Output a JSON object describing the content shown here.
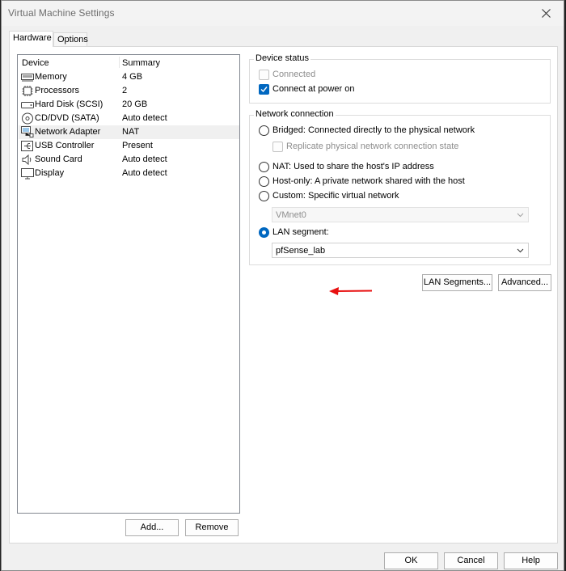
{
  "window": {
    "title": "Virtual Machine Settings"
  },
  "tabs": [
    {
      "label": "Hardware"
    },
    {
      "label": "Options"
    }
  ],
  "device_list": {
    "headers": {
      "device": "Device",
      "summary": "Summary"
    },
    "rows": [
      {
        "name": "Memory",
        "summary": "4 GB",
        "icon": "memory-icon"
      },
      {
        "name": "Processors",
        "summary": "2",
        "icon": "processor-icon"
      },
      {
        "name": "Hard Disk (SCSI)",
        "summary": "20 GB",
        "icon": "hard-disk-icon"
      },
      {
        "name": "CD/DVD (SATA)",
        "summary": "Auto detect",
        "icon": "cd-dvd-icon"
      },
      {
        "name": "Network Adapter",
        "summary": "NAT",
        "icon": "network-adapter-icon"
      },
      {
        "name": "USB Controller",
        "summary": "Present",
        "icon": "usb-icon"
      },
      {
        "name": "Sound Card",
        "summary": "Auto detect",
        "icon": "speaker-icon"
      },
      {
        "name": "Display",
        "summary": "Auto detect",
        "icon": "monitor-icon"
      }
    ],
    "add_label": "Add...",
    "remove_label": "Remove"
  },
  "device_status": {
    "title": "Device status",
    "connected": {
      "label": "Connected",
      "checked": false,
      "enabled": false
    },
    "connect_at_power_on": {
      "label": "Connect at power on",
      "checked": true
    }
  },
  "network_connection": {
    "title": "Network connection",
    "bridged": "Bridged: Connected directly to the physical network",
    "replicate": "Replicate physical network connection state",
    "nat": "NAT: Used to share the host's IP address",
    "host_only": "Host-only: A private network shared with the host",
    "custom": "Custom: Specific virtual network",
    "custom_select": "VMnet0",
    "lan_segment": "LAN segment:",
    "lan_select": "pfSense_lab",
    "selected": "lan_segment"
  },
  "buttons": {
    "lan_segments": "LAN Segments...",
    "advanced": "Advanced...",
    "ok": "OK",
    "cancel": "Cancel",
    "help": "Help"
  },
  "colors": {
    "accent": "#0067c0",
    "annotation_arrow": "#e81010"
  }
}
